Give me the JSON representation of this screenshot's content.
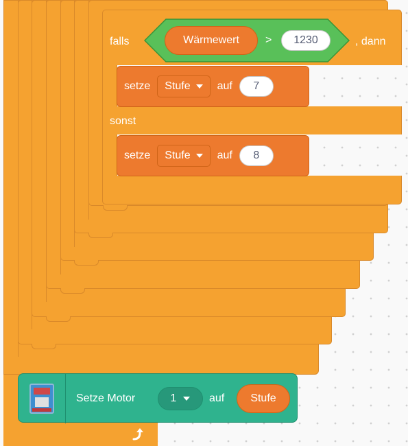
{
  "workspace": {
    "grid": "dotted"
  },
  "if_else": {
    "if_label": "falls",
    "then_label": ", dann",
    "else_label": "sonst",
    "condition": {
      "operator": ">",
      "left_reporter": "Wärmewert",
      "right_value": "1230"
    }
  },
  "set_blocks": [
    {
      "label": "setze",
      "variable": "Stufe",
      "to_label": "auf",
      "value": "7"
    },
    {
      "label": "setze",
      "variable": "Stufe",
      "to_label": "auf",
      "value": "8"
    }
  ],
  "motor_block": {
    "label": "Setze Motor",
    "motor": "1",
    "to_label": "auf",
    "value_reporter": "Stufe",
    "extension_icon": "robot-board-icon"
  },
  "loop_end_icon": "loop-arrow-icon",
  "colors": {
    "control": "#f5a230",
    "variables": "#ed7a2e",
    "operators": "#59c059",
    "extension": "#2fb38e",
    "background": "#f9f9f9"
  }
}
